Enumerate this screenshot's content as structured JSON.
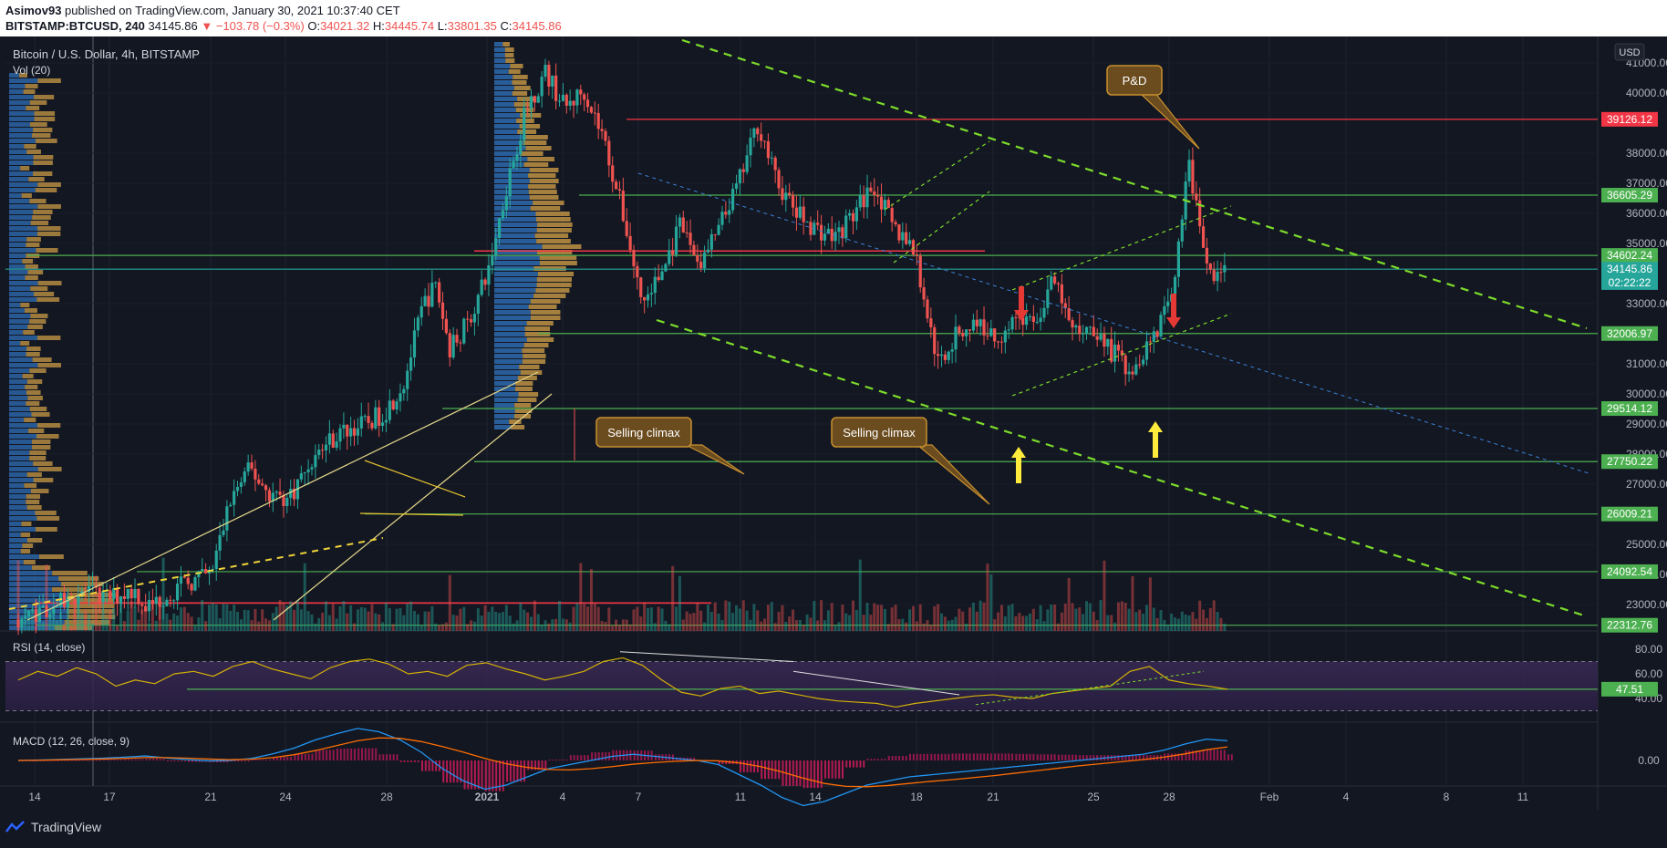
{
  "header": {
    "author": "Asimov93",
    "published_text": " published on TradingView.com, January 30, 2021 10:37:40 CET",
    "symbol": "BITSTAMP:BTCUSD, 240",
    "last": "34145.86",
    "change": "▼ −103.78 (−0.3%)",
    "o_label": "O:",
    "o_value": "34021.32",
    "h_label": "H:",
    "h_value": "34445.74",
    "l_label": "L:",
    "l_value": "33801.35",
    "c_label": "C:",
    "c_value": "34145.86"
  },
  "legend": {
    "title": "Bitcoin / U.S. Dollar, 4h, BITSTAMP",
    "vol": "Vol (20)",
    "rsi": "RSI (14, close)",
    "macd": "MACD (12, 26, close, 9)"
  },
  "currency_button": "USD",
  "footer": {
    "brand": "TradingView"
  },
  "annotations": {
    "pd": "P&D",
    "climax1": "Selling climax",
    "climax2": "Selling climax"
  },
  "colors": {
    "background": "#131722",
    "up": "#26a69a",
    "down": "#ef5350",
    "support": "#4caf50",
    "resistance": "#f23645",
    "trend": "#7cdb2a",
    "rsi_line": "#d4b106",
    "annotation_fill": "#6b4c1f",
    "annotation_border": "#c8902f"
  },
  "chart_data": [
    {
      "type": "candlestick",
      "title": "Bitcoin / U.S. Dollar, 4h, BITSTAMP",
      "y_axis": {
        "ticks": [
          "41000.00",
          "40000.00",
          "38000.00",
          "37000.00",
          "36000.00",
          "35000.00",
          "33000.00",
          "31000.00",
          "30000.00",
          "29000.00",
          "28000.00",
          "27000.00",
          "25000.00",
          "24000.00",
          "23000.00"
        ]
      },
      "x_axis": {
        "ticks": [
          "14",
          "17",
          "21",
          "24",
          "28",
          "2021",
          "4",
          "7",
          "11",
          "14",
          "18",
          "21",
          "25",
          "28",
          "Feb",
          "4",
          "8",
          "11"
        ]
      },
      "price_levels": [
        {
          "label": "39126.12",
          "value": 39126.12,
          "color": "#f23645"
        },
        {
          "label": "36605.29",
          "value": 36605.29,
          "color": "#4caf50"
        },
        {
          "label": "34602.24",
          "value": 34602.24,
          "color": "#4caf50"
        },
        {
          "label": "34145.86",
          "value": 34145.86,
          "color": "#26a69a"
        },
        {
          "label": "02:22:22",
          "value": 33700,
          "color": "#26a69a"
        },
        {
          "label": "32006.97",
          "value": 32006.97,
          "color": "#4caf50"
        },
        {
          "label": "29514.12",
          "value": 29514.12,
          "color": "#4caf50"
        },
        {
          "label": "27750.22",
          "value": 27750.22,
          "color": "#4caf50"
        },
        {
          "label": "26009.21",
          "value": 26009.21,
          "color": "#4caf50"
        },
        {
          "label": "24092.54",
          "value": 24092.54,
          "color": "#4caf50"
        },
        {
          "label": "22312.76",
          "value": 22312.76,
          "color": "#4caf50"
        }
      ],
      "ylim": [
        22050,
        41800
      ],
      "price_path": [
        [
          0,
          22500
        ],
        [
          5,
          22900
        ],
        [
          10,
          23400
        ],
        [
          14,
          23200
        ],
        [
          18,
          23500
        ],
        [
          20,
          22900
        ],
        [
          23,
          23300
        ],
        [
          26,
          23700
        ],
        [
          30,
          24000
        ],
        [
          33,
          26500
        ],
        [
          36,
          27500
        ],
        [
          39,
          26700
        ],
        [
          42,
          26500
        ],
        [
          45,
          27600
        ],
        [
          48,
          28400
        ],
        [
          51,
          28800
        ],
        [
          54,
          29000
        ],
        [
          57,
          29400
        ],
        [
          60,
          30400
        ],
        [
          63,
          33000
        ],
        [
          65,
          33600
        ],
        [
          67,
          31500
        ],
        [
          70,
          32400
        ],
        [
          73,
          34000
        ],
        [
          76,
          37000
        ],
        [
          79,
          39500
        ],
        [
          82,
          40700
        ],
        [
          85,
          39500
        ],
        [
          88,
          40100
        ],
        [
          91,
          38500
        ],
        [
          94,
          36000
        ],
        [
          97,
          33000
        ],
        [
          100,
          34000
        ],
        [
          103,
          35600
        ],
        [
          106,
          34300
        ],
        [
          109,
          35500
        ],
        [
          112,
          37000
        ],
        [
          115,
          39000
        ],
        [
          118,
          37000
        ],
        [
          121,
          36000
        ],
        [
          124,
          35500
        ],
        [
          127,
          35200
        ],
        [
          130,
          36000
        ],
        [
          133,
          37000
        ],
        [
          136,
          35500
        ],
        [
          139,
          35000
        ],
        [
          141,
          33000
        ],
        [
          143,
          31000
        ],
        [
          146,
          32000
        ],
        [
          149,
          32400
        ],
        [
          152,
          31800
        ],
        [
          155,
          32600
        ],
        [
          158,
          32300
        ],
        [
          161,
          33800
        ],
        [
          164,
          32000
        ],
        [
          167,
          32300
        ],
        [
          170,
          31400
        ],
        [
          173,
          30800
        ],
        [
          176,
          31800
        ],
        [
          179,
          32900
        ],
        [
          182,
          37600
        ],
        [
          185,
          34000
        ],
        [
          188,
          34145.86
        ]
      ]
    },
    {
      "type": "line",
      "title": "RSI (14, close)",
      "y_axis": {
        "ticks": [
          "80.00",
          "60.00",
          "40.00"
        ]
      },
      "ylim": [
        25,
        82
      ],
      "last_value_label": "47.51",
      "series": [
        {
          "values": [
            55,
            62,
            58,
            65,
            60,
            50,
            55,
            52,
            60,
            62,
            58,
            66,
            70,
            64,
            60,
            56,
            65,
            70,
            72,
            68,
            60,
            62,
            58,
            67,
            69,
            64,
            60,
            55,
            58,
            62,
            70,
            73,
            67,
            55,
            45,
            42,
            48,
            50,
            44,
            46,
            43,
            40,
            38,
            37,
            36,
            33,
            36,
            38,
            40,
            42,
            43,
            41,
            40,
            44,
            46,
            48,
            50,
            62,
            66,
            55,
            52,
            50,
            47.51
          ]
        }
      ]
    },
    {
      "type": "line",
      "title": "MACD (12, 26, close, 9)",
      "y_axis": {
        "ticks": [
          "0.00"
        ]
      },
      "ylim": [
        -1300,
        900
      ],
      "series": [
        {
          "values": [
            0,
            10,
            25,
            40,
            55,
            80,
            110,
            60,
            20,
            -10,
            0,
            50,
            160,
            300,
            500,
            650,
            780,
            700,
            500,
            200,
            -200,
            -500,
            -700,
            -600,
            -400,
            -200,
            -100,
            0,
            100,
            150,
            100,
            50,
            0,
            -100,
            -350,
            -600,
            -900,
            -1100,
            -1000,
            -800,
            -600,
            -500,
            -400,
            -350,
            -300,
            -250,
            -200,
            -150,
            -100,
            -50,
            0,
            50,
            100,
            150,
            250,
            400,
            520,
            480
          ]
        },
        {
          "values": [
            0,
            5,
            15,
            25,
            35,
            50,
            70,
            70,
            55,
            35,
            20,
            30,
            70,
            140,
            240,
            360,
            480,
            550,
            540,
            460,
            340,
            200,
            50,
            -80,
            -170,
            -220,
            -230,
            -200,
            -150,
            -90,
            -50,
            -20,
            0,
            -10,
            -60,
            -150,
            -280,
            -430,
            -560,
            -630,
            -640,
            -610,
            -560,
            -510,
            -470,
            -420,
            -370,
            -310,
            -250,
            -190,
            -130,
            -80,
            -30,
            20,
            80,
            160,
            260,
            330
          ]
        }
      ]
    }
  ]
}
